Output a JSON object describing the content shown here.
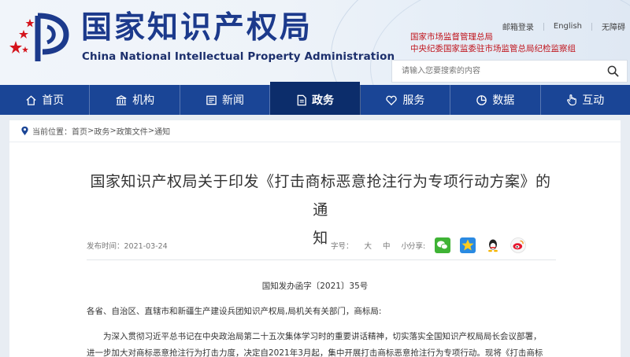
{
  "header": {
    "org_name_cn": "国家知识产权局",
    "org_name_en": "China National Intellectual Property Administration",
    "top_links": [
      "邮箱登录",
      "English",
      "无障碍"
    ],
    "supervising_orgs": [
      "国家市场监督管理总局",
      "中央纪委国家监委驻市场监管总局纪检监察组"
    ],
    "search": {
      "placeholder": "请输入您要搜索的内容"
    }
  },
  "nav": {
    "items": [
      {
        "label": "首页",
        "icon": "home-icon"
      },
      {
        "label": "机构",
        "icon": "institution-icon"
      },
      {
        "label": "新闻",
        "icon": "news-icon"
      },
      {
        "label": "政务",
        "icon": "document-icon",
        "active": true
      },
      {
        "label": "服务",
        "icon": "service-icon"
      },
      {
        "label": "数据",
        "icon": "data-icon"
      },
      {
        "label": "互动",
        "icon": "hand-icon"
      }
    ]
  },
  "breadcrumb": {
    "label": "当前位置：",
    "path": [
      "首页",
      "政务",
      "政策文件",
      "通知"
    ],
    "separator": ">"
  },
  "article": {
    "title_line1": "国家知识产权局关于印发《打击商标恶意抢注行为专项行动方案》的通",
    "title_line2": "知",
    "publish_label": "发布时间：",
    "publish_date": "2021-03-24",
    "font_size_label": "字号：",
    "font_sizes": [
      "大",
      "中",
      "小"
    ],
    "share_label": "分享:",
    "share_targets": [
      "wechat-icon",
      "qzone-icon",
      "qq-icon",
      "weibo-icon"
    ],
    "doc_number": "国知发办函字〔2021〕35号",
    "addressee": "各省、自治区、直辖市和新疆生产建设兵团知识产权局,局机关有关部门，商标局:",
    "body_line1": "为深入贯彻习近平总书记在中央政治局第二十五次集体学习时的重要讲话精神，切实落实全国知识产权局局长会议部署，",
    "body_line2": "进一步加大对商标恶意抢注行为打击力度，决定自2021年3月起，集中开展打击商标恶意抢注行为专项行动。现将《打击商标"
  },
  "colors": {
    "nav_bg": "#1a4596",
    "nav_active": "#0c2d6b",
    "brand_blue": "#1c3a8c",
    "accent_red": "#c0141c"
  }
}
